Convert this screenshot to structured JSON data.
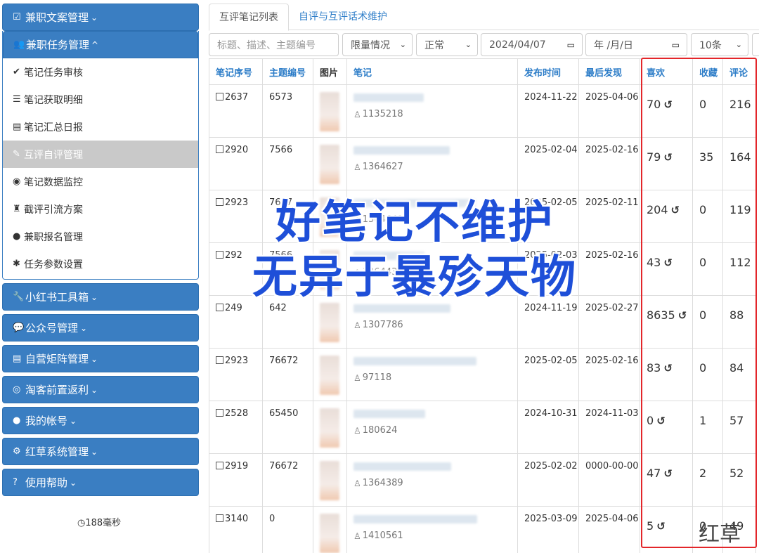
{
  "sidebar": {
    "menus": [
      {
        "icon": "☑",
        "label": "兼职文案管理",
        "chev": "❯"
      },
      {
        "icon": "👥",
        "label": "兼职任务管理",
        "chev": "^"
      }
    ],
    "submenu": [
      {
        "icon": "✔",
        "label": "笔记任务审核"
      },
      {
        "icon": "☰",
        "label": "笔记获取明细"
      },
      {
        "icon": "▤",
        "label": "笔记汇总日报"
      },
      {
        "icon": "✎",
        "label": "互评自评管理"
      },
      {
        "icon": "◉",
        "label": "笔记数据监控"
      },
      {
        "icon": "♜",
        "label": "截评引流方案"
      },
      {
        "icon": "●",
        "label": "兼职报名管理"
      },
      {
        "icon": "✱",
        "label": "任务参数设置"
      }
    ],
    "menus_after": [
      {
        "icon": "🔧",
        "label": "小红书工具箱"
      },
      {
        "icon": "💬",
        "label": "公众号管理"
      },
      {
        "icon": "▤",
        "label": "自营矩阵管理"
      },
      {
        "icon": "◎",
        "label": "淘客前置返利"
      },
      {
        "icon": "●",
        "label": "我的帐号"
      },
      {
        "icon": "⚙",
        "label": "红草系统管理"
      },
      {
        "icon": "?",
        "label": "使用帮助"
      }
    ],
    "timer": "188毫秒"
  },
  "tabs": [
    "互评笔记列表",
    "自评与互评话术维护"
  ],
  "filters": {
    "search_placeholder": "标题、描述、主题编号",
    "limit": "限量情况",
    "status": "正常",
    "date_from": "2024/04/07",
    "date_to": "年 /月/日",
    "page_size": "10条"
  },
  "table": {
    "headers": [
      "笔记序号",
      "主题编号",
      "图片",
      "笔记",
      "发布时间",
      "最后发现",
      "喜欢",
      "收藏",
      "评论"
    ],
    "rows": [
      {
        "id": "2637",
        "topic": "6573",
        "user": "1135218",
        "pub": "2024-11-22",
        "last": "2025-04-06",
        "likes": "70",
        "favs": "0",
        "comments": "216"
      },
      {
        "id": "2920",
        "topic": "7566",
        "user": "1364627",
        "pub": "2025-02-04",
        "last": "2025-02-16",
        "likes": "79",
        "favs": "35",
        "comments": "164"
      },
      {
        "id": "2923",
        "topic": "7667",
        "user": "1364641",
        "pub": "2025-02-05",
        "last": "2025-02-11",
        "likes": "204",
        "favs": "0",
        "comments": "119"
      },
      {
        "id": "292",
        "topic": "7566",
        "user": "1364432",
        "pub": "2025-02-03",
        "last": "2025-02-16",
        "likes": "43",
        "favs": "0",
        "comments": "112"
      },
      {
        "id": "249",
        "topic": "642",
        "user": "1307786",
        "pub": "2024-11-19",
        "last": "2025-02-27",
        "likes": "8635",
        "favs": "0",
        "comments": "88"
      },
      {
        "id": "2923",
        "topic": "76672",
        "user": "97118",
        "pub": "2025-02-05",
        "last": "2025-02-16",
        "likes": "83",
        "favs": "0",
        "comments": "84"
      },
      {
        "id": "2528",
        "topic": "65450",
        "user": "180624",
        "pub": "2024-10-31",
        "last": "2024-11-03",
        "likes": "0",
        "favs": "1",
        "comments": "57"
      },
      {
        "id": "2919",
        "topic": "76672",
        "user": "1364389",
        "pub": "2025-02-02",
        "last": "0000-00-00",
        "likes": "47",
        "favs": "2",
        "comments": "52"
      },
      {
        "id": "3140",
        "topic": "0",
        "user": "1410561",
        "pub": "2025-03-09",
        "last": "2025-04-06",
        "likes": "5",
        "favs": "0",
        "comments": "49"
      }
    ]
  },
  "overlay": {
    "line1": "好笔记不维护",
    "line2": "无异于暴殄天物"
  },
  "watermark": "红草",
  "colors": {
    "primary": "#3a7ec2",
    "link": "#2d7dc8",
    "highlight_box": "#e3262a",
    "overlay_text": "#1e4fd8"
  }
}
